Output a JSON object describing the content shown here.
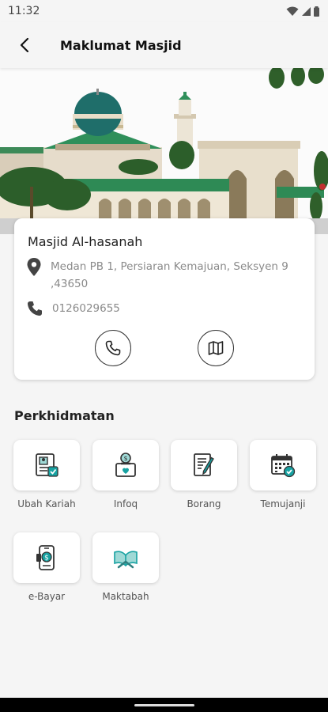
{
  "status_bar": {
    "time": "11:32"
  },
  "app_bar": {
    "title": "Maklumat Masjid"
  },
  "mosque": {
    "name": "Masjid Al-hasanah",
    "address": "Medan PB 1, Persiaran Kemajuan, Seksyen 9  ,43650",
    "phone": "0126029655"
  },
  "services": {
    "title": "Perkhidmatan",
    "items": [
      {
        "label": "Ubah Kariah",
        "icon": "id-card-icon"
      },
      {
        "label": "Infoq",
        "icon": "donation-box-icon"
      },
      {
        "label": "Borang",
        "icon": "form-icon"
      },
      {
        "label": "Temujanji",
        "icon": "calendar-check-icon"
      },
      {
        "label": "e-Bayar",
        "icon": "mobile-payment-icon"
      },
      {
        "label": "Maktabah",
        "icon": "book-icon"
      }
    ]
  },
  "colors": {
    "accent": "#17a2a2",
    "icon_dark": "#333333"
  }
}
